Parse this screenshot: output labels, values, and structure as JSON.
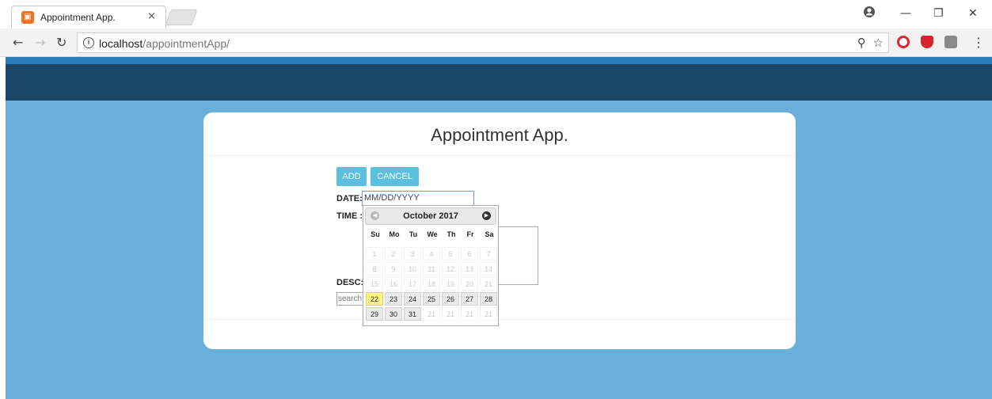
{
  "browser": {
    "tab_title": "Appointment App.",
    "tab_close": "×",
    "url_host": "localhost",
    "url_path": "/appointmentApp/",
    "window_controls": [
      "—",
      "❐",
      "✕"
    ]
  },
  "app": {
    "title": "Appointment App.",
    "buttons": {
      "add": "ADD",
      "cancel": "CANCEL"
    },
    "labels": {
      "date": "DATE:",
      "time": "TIME :",
      "desc": "DESC:"
    },
    "date_placeholder": "MM/DD/YYYY",
    "search_placeholder": "search"
  },
  "datepicker": {
    "title": "October 2017",
    "days_of_week": [
      "Su",
      "Mo",
      "Tu",
      "We",
      "Th",
      "Fr",
      "Sa"
    ],
    "weeks": [
      [
        {
          "d": "1",
          "s": "dis"
        },
        {
          "d": "2",
          "s": "dis"
        },
        {
          "d": "3",
          "s": "dis"
        },
        {
          "d": "4",
          "s": "dis"
        },
        {
          "d": "5",
          "s": "dis"
        },
        {
          "d": "6",
          "s": "dis"
        },
        {
          "d": "7",
          "s": "dis"
        }
      ],
      [
        {
          "d": "8",
          "s": "dis"
        },
        {
          "d": "9",
          "s": "dis"
        },
        {
          "d": "10",
          "s": "dis"
        },
        {
          "d": "11",
          "s": "dis"
        },
        {
          "d": "12",
          "s": "dis"
        },
        {
          "d": "13",
          "s": "dis"
        },
        {
          "d": "14",
          "s": "dis"
        }
      ],
      [
        {
          "d": "15",
          "s": "dis"
        },
        {
          "d": "16",
          "s": "dis"
        },
        {
          "d": "17",
          "s": "dis"
        },
        {
          "d": "18",
          "s": "dis"
        },
        {
          "d": "19",
          "s": "dis"
        },
        {
          "d": "20",
          "s": "dis"
        },
        {
          "d": "21",
          "s": "dis"
        }
      ],
      [
        {
          "d": "22",
          "s": "today"
        },
        {
          "d": "23",
          "s": "act"
        },
        {
          "d": "24",
          "s": "act"
        },
        {
          "d": "25",
          "s": "act"
        },
        {
          "d": "26",
          "s": "act"
        },
        {
          "d": "27",
          "s": "act"
        },
        {
          "d": "28",
          "s": "act"
        }
      ],
      [
        {
          "d": "29",
          "s": "act"
        },
        {
          "d": "30",
          "s": "act"
        },
        {
          "d": "31",
          "s": "act"
        },
        {
          "d": "21",
          "s": "dis"
        },
        {
          "d": "21",
          "s": "dis"
        },
        {
          "d": "21",
          "s": "dis"
        },
        {
          "d": "21",
          "s": "dis"
        }
      ]
    ]
  },
  "colors": {
    "page_bg": "#6aafdc",
    "header_bar": "#1a4766",
    "button": "#5bc0de",
    "today": "#fff48f"
  }
}
